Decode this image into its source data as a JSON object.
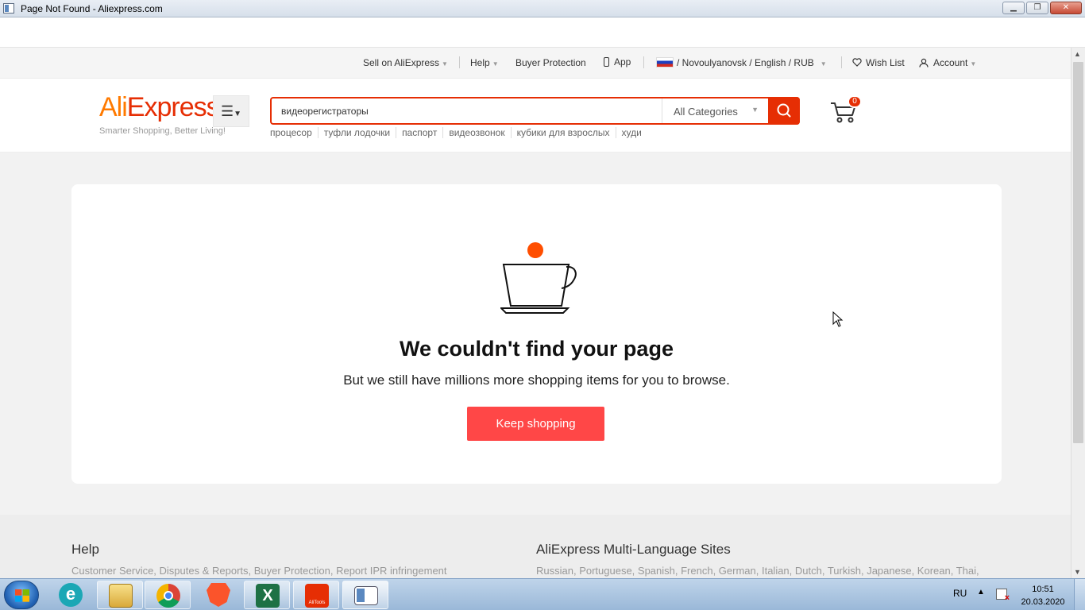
{
  "window": {
    "title": "Page Not Found - Aliexpress.com",
    "minimize": "▁",
    "maximize": "❐",
    "close": "✕"
  },
  "topbar": {
    "sell": "Sell on AliExpress",
    "help": "Help",
    "buyer_protection": "Buyer Protection",
    "app": "App",
    "region": "/ Novoulyanovsk / English /  RUB",
    "wish_list": "Wish List",
    "account": "Account"
  },
  "header": {
    "logo_prefix": "Ali",
    "logo_suffix": "Express",
    "tagline": "Smarter Shopping, Better Living!",
    "search_value": "видеорегистраторы",
    "category": "All Categories",
    "cart_count": "0",
    "hot_searches": [
      "процесор",
      "туфли лодочки",
      "паспорт",
      "видеозвонок",
      "кубики для взрослых",
      "худи"
    ]
  },
  "error": {
    "heading": "We couldn't find your page",
    "message": "But we still have millions more shopping items for you to browse.",
    "button": "Keep shopping"
  },
  "footer": {
    "help_heading": "Help",
    "help_links": "Customer Service, Disputes & Reports, Buyer Protection, Report IPR infringement",
    "multi_heading": "AliExpress Multi-Language Sites",
    "multi_links": "Russian, Portuguese, Spanish, French, German, Italian, Dutch, Turkish, Japanese, Korean, Thai,"
  },
  "taskbar": {
    "apps": [
      "eset-icon",
      "file-explorer-icon",
      "chrome-icon",
      "brave-icon",
      "excel-icon",
      "aliexpress-icon",
      "window-app-icon"
    ],
    "aliexpress_label": "AliTools",
    "language": "RU",
    "time": "10:51",
    "date": "20.03.2020"
  },
  "colors": {
    "brand_red": "#e62e04",
    "button_red": "#ff4747",
    "logo_orange": "#ff7a00"
  }
}
